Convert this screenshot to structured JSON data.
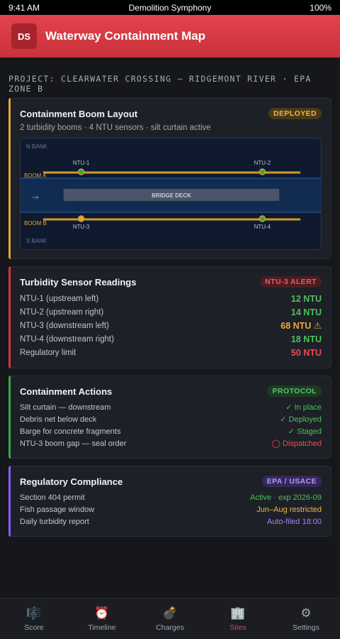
{
  "status": {
    "time": "9:41 AM",
    "app": "Demolition Symphony",
    "battery": "100%"
  },
  "header": {
    "logo": "DS",
    "title": "Waterway Containment Map"
  },
  "project": "PROJECT: CLEARWATER CROSSING — RIDGEMONT RIVER · EPA ZONE B",
  "boom": {
    "title": "Containment Boom Layout",
    "badge": "DEPLOYED",
    "subtitle": "2 turbidity booms · 4 NTU sensors · silt curtain active",
    "map": {
      "n_bank": "N BANK",
      "s_bank": "S BANK",
      "boom_a": "BOOM A",
      "boom_b": "BOOM B",
      "bridge": "BRIDGE DECK",
      "flow_arrow": "→",
      "sensors": [
        "NTU-1",
        "NTU-2",
        "NTU-3",
        "NTU-4"
      ]
    }
  },
  "turbidity": {
    "title": "Turbidity Sensor Readings",
    "badge": "NTU-3 ALERT",
    "rows": [
      {
        "label": "NTU-1 (upstream left)",
        "value": "12 NTU"
      },
      {
        "label": "NTU-2 (upstream right)",
        "value": "14 NTU"
      },
      {
        "label": "NTU-3 (downstream left)",
        "value": "68 NTU ⚠"
      },
      {
        "label": "NTU-4 (downstream right)",
        "value": "18 NTU"
      },
      {
        "label": "Regulatory limit",
        "value": "50 NTU"
      }
    ]
  },
  "actions": {
    "title": "Containment Actions",
    "badge": "PROTOCOL",
    "rows": [
      {
        "label": "Silt curtain — downstream",
        "status": "✓ In place"
      },
      {
        "label": "Debris net below deck",
        "status": "✓ Deployed"
      },
      {
        "label": "Barge for concrete fragments",
        "status": "✓ Staged"
      },
      {
        "label": "NTU-3 boom gap — seal order",
        "status": "◯ Dispatched"
      }
    ]
  },
  "compliance": {
    "title": "Regulatory Compliance",
    "badge": "EPA / USACE",
    "rows": [
      {
        "label": "Section 404 permit",
        "status": "Active · exp 2026-09"
      },
      {
        "label": "Fish passage window",
        "status": "Jun–Aug restricted"
      },
      {
        "label": "Daily turbidity report",
        "status": "Auto-filed 18:00"
      }
    ]
  },
  "tabs": [
    {
      "label": "Score",
      "icon": "🎼"
    },
    {
      "label": "Timeline",
      "icon": "⏰"
    },
    {
      "label": "Charges",
      "icon": "💣"
    },
    {
      "label": "Sites",
      "icon": "🏢"
    },
    {
      "label": "Settings",
      "icon": "⚙"
    }
  ],
  "colors": {
    "accent": "#e2434d",
    "ok": "#4cc15c",
    "warn": "#f0a93c",
    "alert": "#ef4a55",
    "info": "#a580f8"
  }
}
